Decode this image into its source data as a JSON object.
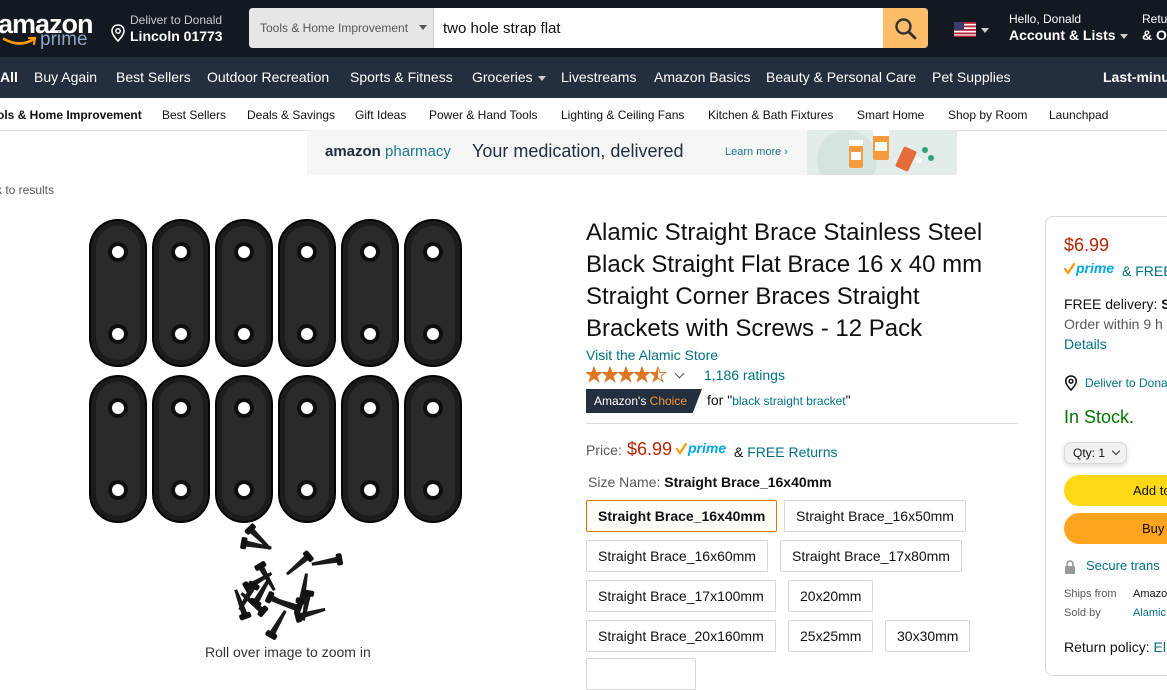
{
  "header": {
    "logo": {
      "main": "amazon",
      "sub": "prime"
    },
    "deliver": {
      "line1": "Deliver to Donald",
      "line2": "Lincoln 01773"
    },
    "search": {
      "category": "Tools & Home Improvement",
      "query": "two hole strap flat"
    },
    "account": {
      "greeting": "Hello, Donald",
      "label": "Account & Lists"
    },
    "returns": {
      "line1": "Retu",
      "line2": "& O"
    }
  },
  "nav": {
    "all": "All",
    "items": [
      "Buy Again",
      "Best Sellers",
      "Outdoor Recreation",
      "Sports & Fitness",
      "Groceries",
      "Livestreams",
      "Amazon Basics",
      "Beauty & Personal Care",
      "Pet Supplies"
    ],
    "right": "Last-minu"
  },
  "subnav": {
    "category": "ols & Home Improvement",
    "items": [
      "Best Sellers",
      "Deals & Savings",
      "Gift Ideas",
      "Power & Hand Tools",
      "Lighting & Ceiling Fans",
      "Kitchen & Bath Fixtures",
      "Smart Home",
      "Shop by Room",
      "Launchpad"
    ]
  },
  "banner": {
    "brand_a": "amazon",
    "brand_b": "pharmacy",
    "tagline": "Your medication, delivered",
    "cta": "Learn more ›"
  },
  "back_link": "k to results",
  "image": {
    "zoom_hint": "Roll over image to zoom in"
  },
  "product": {
    "title": "Alamic Straight Brace Stainless Steel Black Straight Flat Brace 16 x 40 mm Straight Corner Braces Straight Brackets with Screws - 12 Pack",
    "store": "Visit the Alamic Store",
    "rating_value": 4.5,
    "ratings_count": "1,186 ratings",
    "badge_a": "Amazon's",
    "badge_b": "Choice",
    "for_prefix": "for \"",
    "for_keyword": "black straight bracket",
    "for_suffix": "\"",
    "price_label": "Price:",
    "price": "$6.99",
    "prime": "prime",
    "returns_amp": "&",
    "returns": "FREE Returns",
    "size_label": "Size Name:",
    "size_value": "Straight Brace_16x40mm",
    "sizes": [
      "Straight Brace_16x40mm",
      "Straight Brace_16x50mm",
      "Straight Brace_16x60mm",
      "Straight Brace_17x80mm",
      "Straight Brace_17x100mm",
      "20x20mm",
      "Straight Brace_20x160mm",
      "25x25mm",
      "30x30mm"
    ],
    "selected_size_index": 0
  },
  "buybox": {
    "price": "$6.99",
    "prime": "prime",
    "free_amp": "&",
    "free": "FREE",
    "delivery_a": "FREE delivery:",
    "delivery_b": "S",
    "order_within": "Order within 9 h",
    "details": "Details",
    "deliver_to": "Deliver to Donal",
    "stock": "In Stock.",
    "qty": "Qty: 1",
    "add_to_cart": "Add to",
    "buy_now": "Buy",
    "secure": "Secure trans",
    "ships_from_label": "Ships from",
    "ships_from_value": "Amazo",
    "sold_by_label": "Sold by",
    "sold_by_value": "Alamic",
    "return_policy_label": "Return policy:",
    "return_policy_value": "El"
  },
  "colors": {
    "accent": "#febd69",
    "price": "#B12704",
    "link": "#007185",
    "stock": "#007600",
    "topbar": "#131921",
    "navbar": "#232f3e"
  }
}
